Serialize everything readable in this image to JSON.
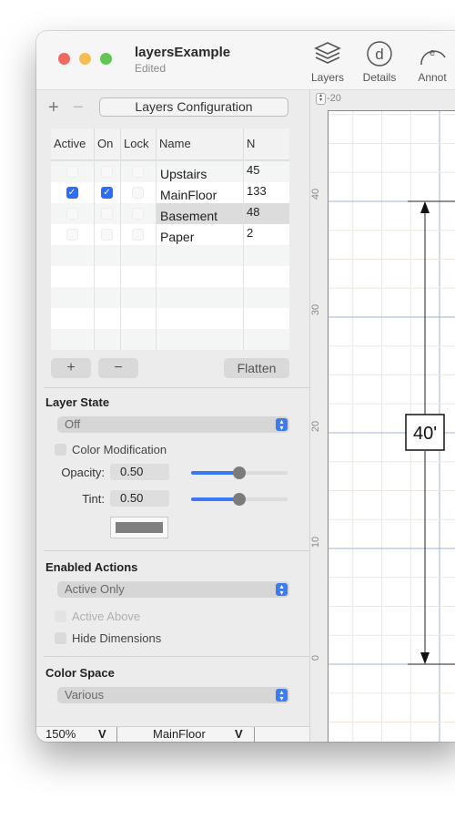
{
  "window": {
    "title": "layersExample",
    "subtitle": "Edited",
    "toolbar": [
      {
        "label": "Layers",
        "icon": "layers-icon"
      },
      {
        "label": "Details",
        "icon": "details-icon"
      },
      {
        "label": "Annot",
        "icon": "annotate-icon"
      }
    ]
  },
  "sidebar": {
    "add_label": "+",
    "remove_label": "−",
    "config_button": "Layers Configuration",
    "table": {
      "columns": [
        "Active",
        "On",
        "Lock",
        "Name",
        "N"
      ],
      "rows": [
        {
          "active": false,
          "on": false,
          "lock": false,
          "name": "Upstairs",
          "n": "45"
        },
        {
          "active": true,
          "on": true,
          "lock": false,
          "name": "MainFloor",
          "n": "133"
        },
        {
          "active": false,
          "on": false,
          "lock": false,
          "name": "Basement",
          "n": "48",
          "selected": true
        },
        {
          "active": false,
          "on": false,
          "lock": false,
          "name": "Paper",
          "n": "2"
        }
      ]
    },
    "add_button": "+",
    "remove_button": "−",
    "flatten_button": "Flatten",
    "layer_state": {
      "title": "Layer State",
      "popup_value": "Off",
      "color_modification_label": "Color Modification",
      "color_modification_checked": false,
      "opacity_label": "Opacity:",
      "opacity_value": "0.50",
      "opacity_fraction": 0.5,
      "tint_label": "Tint:",
      "tint_value": "0.50",
      "tint_fraction": 0.5,
      "swatch_color": "#7f7f7f"
    },
    "enabled_actions": {
      "title": "Enabled Actions",
      "popup_value": "Active Only",
      "active_above_label": "Active Above",
      "active_above_enabled": false,
      "hide_dimensions_label": "Hide Dimensions",
      "hide_dimensions_checked": false
    },
    "color_space": {
      "title": "Color Space",
      "popup_value": "Various"
    }
  },
  "statusbar": {
    "zoom": "150%",
    "layer": "MainFloor",
    "chevron": "V"
  },
  "canvas": {
    "ruler_top_labels": [
      "-20"
    ],
    "ruler_left_labels": [
      "40",
      "30",
      "20",
      "10",
      "0"
    ],
    "dimension_label": "40'",
    "accent_color": "#3b78ef"
  }
}
